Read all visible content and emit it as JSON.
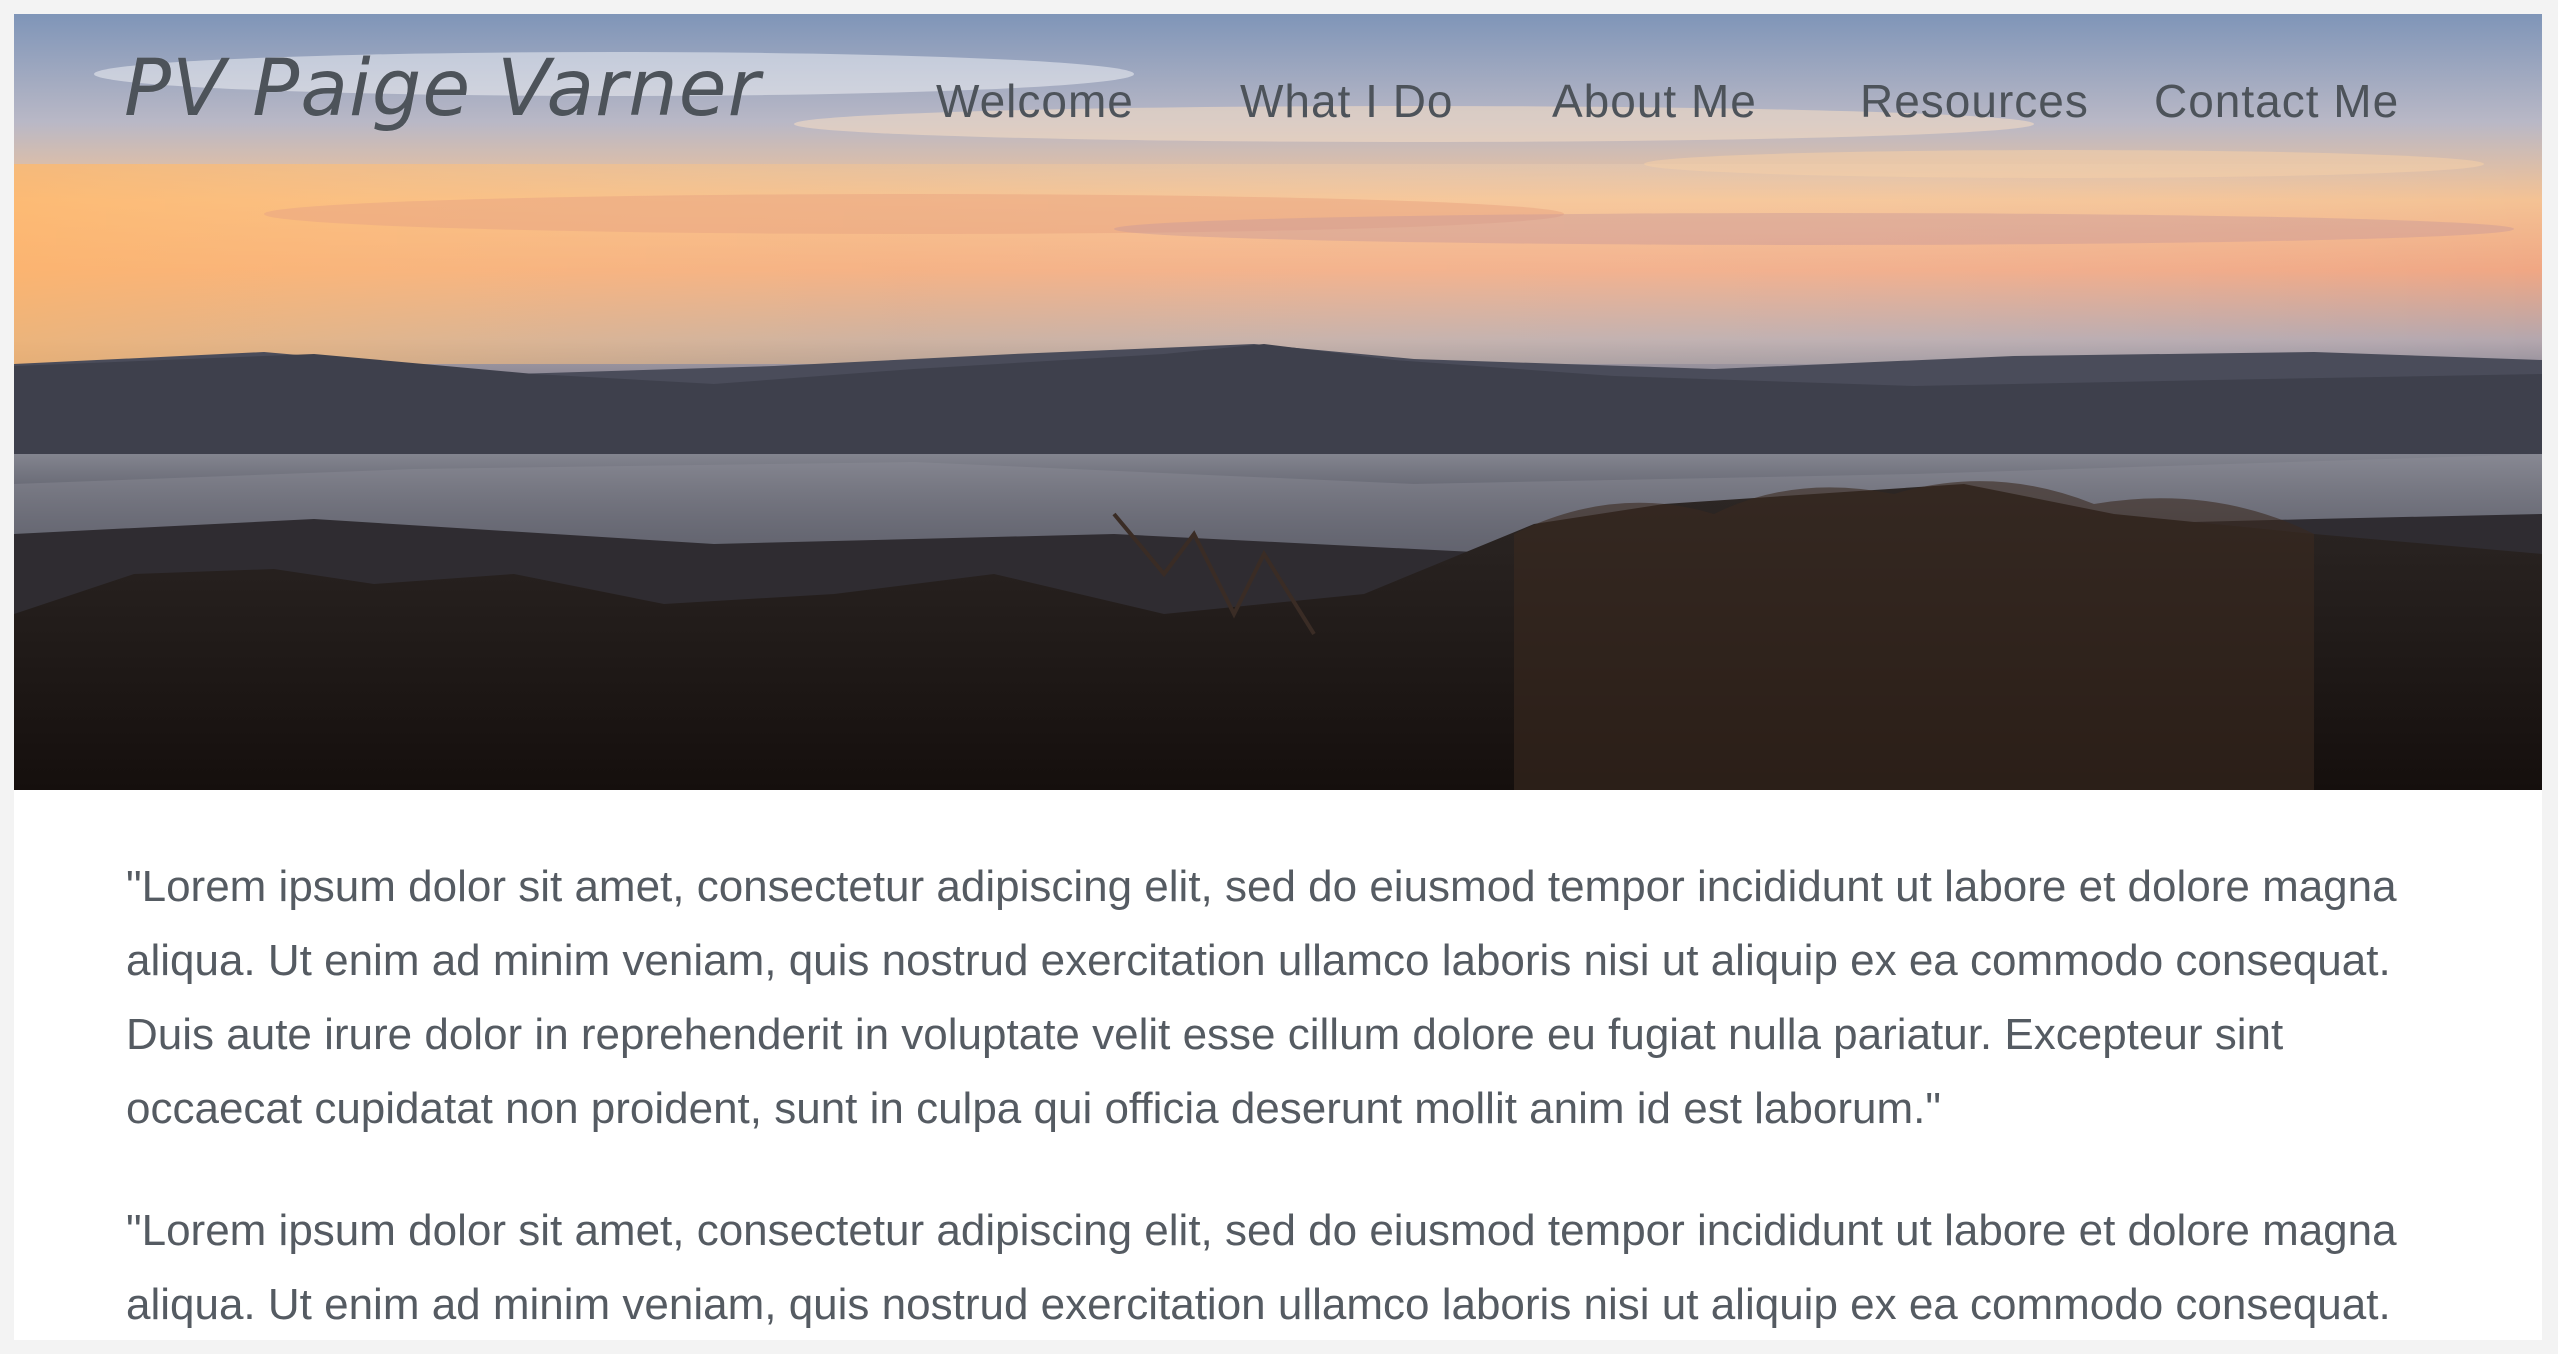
{
  "header": {
    "brand": "PV Paige Varner"
  },
  "nav": {
    "items": [
      {
        "label": "Welcome"
      },
      {
        "label": "What I Do"
      },
      {
        "label": "About Me"
      },
      {
        "label": "Resources"
      },
      {
        "label": "Contact Me"
      }
    ]
  },
  "hero": {
    "image": "mountain-sunset-landscape",
    "colors": {
      "sky_top": "#8a9fc0",
      "sky_glow": "#f2b27a",
      "horizon": "#e7a88a",
      "mountains": "#3a3e4a",
      "forest": "#1f1a17"
    }
  },
  "content": {
    "paragraphs": [
      "\"Lorem ipsum dolor sit amet, consectetur adipiscing elit, sed do eiusmod tempor incididunt ut labore et dolore magna aliqua. Ut enim ad minim veniam, quis nostrud exercitation ullamco laboris nisi ut aliquip ex ea commodo consequat. Duis aute irure dolor in reprehenderit in voluptate velit esse cillum dolore eu fugiat nulla pariatur. Excepteur sint occaecat cupidatat non proident, sunt in culpa qui officia deserunt mollit anim id est laborum.\"",
      "\"Lorem ipsum dolor sit amet, consectetur adipiscing elit, sed do eiusmod tempor incididunt ut labore et dolore magna aliqua. Ut enim ad minim veniam, quis nostrud exercitation ullamco laboris nisi ut aliquip ex ea commodo consequat."
    ]
  }
}
